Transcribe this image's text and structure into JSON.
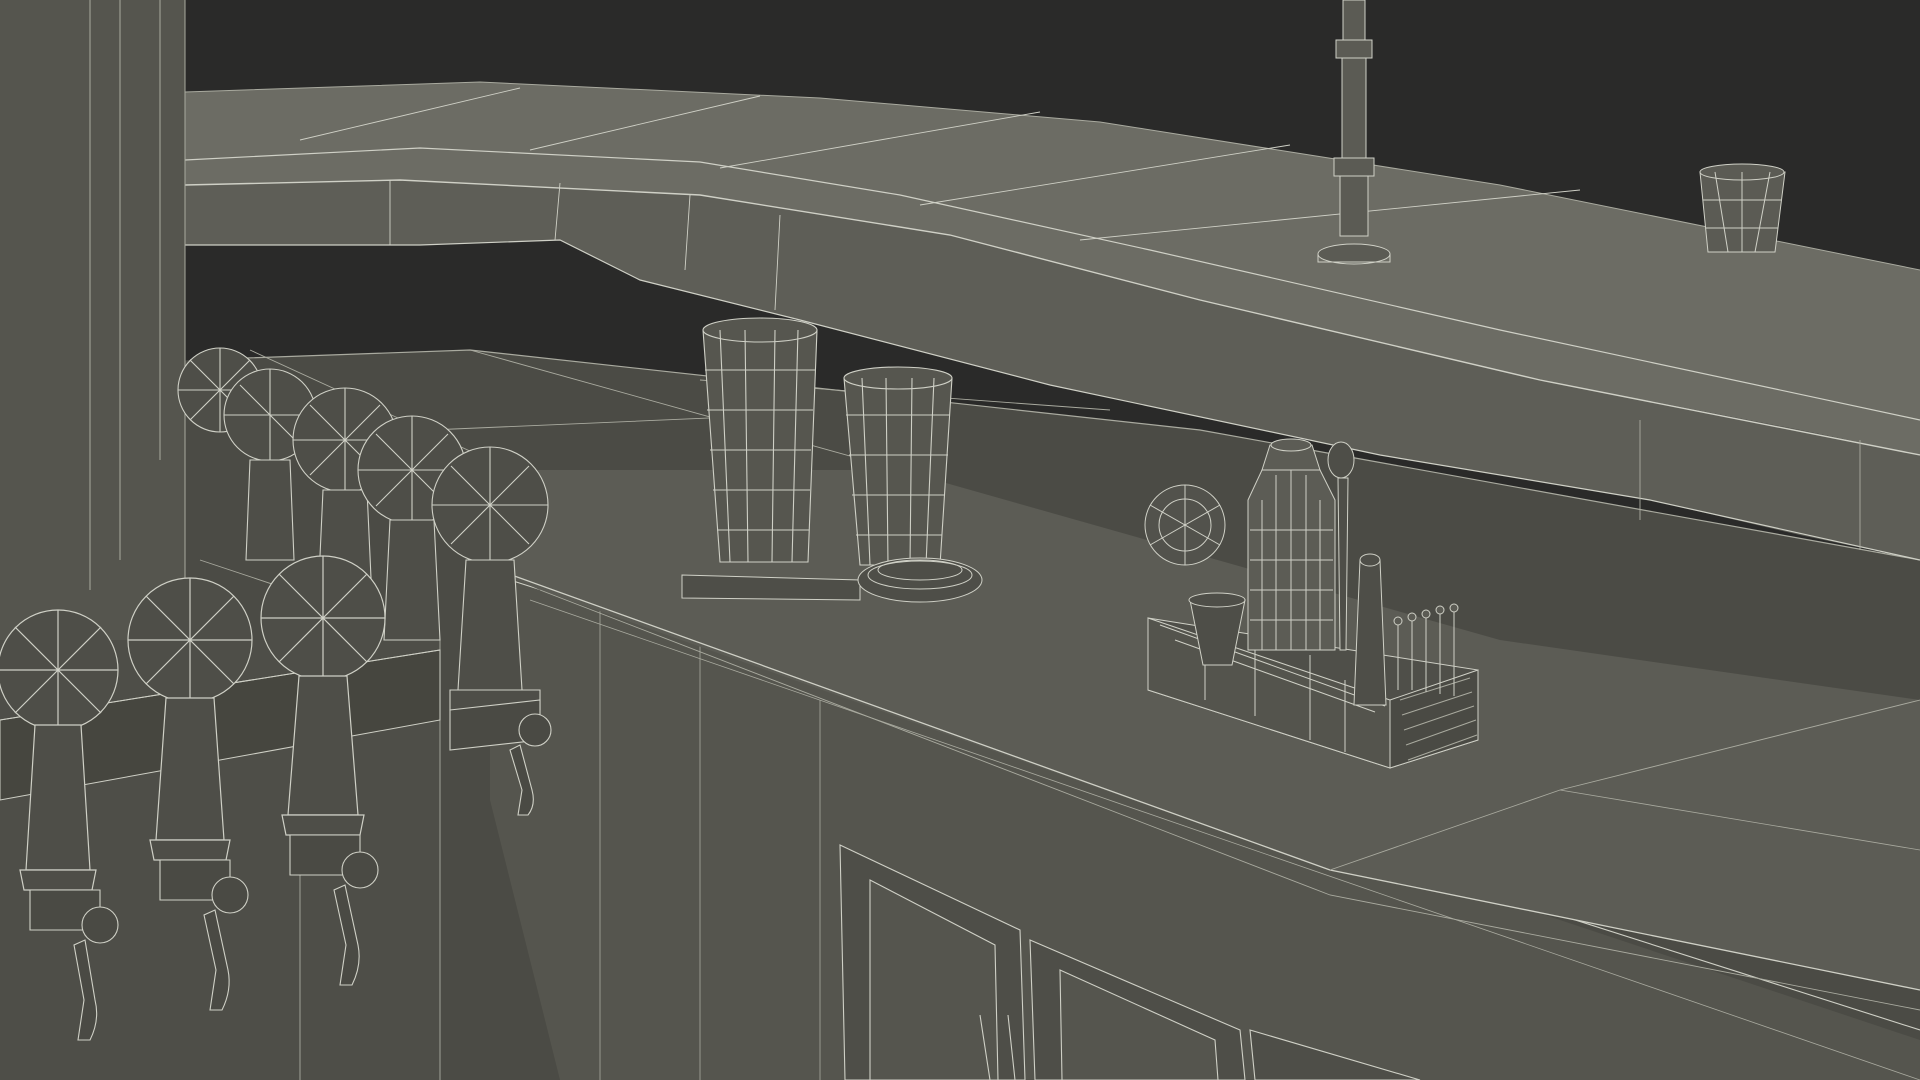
{
  "scene": {
    "colors": {
      "background": "#2a2a29",
      "surface_top": "#6c6c64",
      "surface_mid": "#5b5b54",
      "surface_dark": "#46463f",
      "shadow": "#3a3a35",
      "wire": "#cfd0c6",
      "wire_dim": "#a9aa9f"
    },
    "objects": [
      "bar-counter-top",
      "beer-tap-handles",
      "beer-faucets",
      "mixing-glasses",
      "cocktail-strainer",
      "bar-tool-caddy",
      "cocktail-shaker",
      "cocktail-picks",
      "shot-glass",
      "footrest-pole",
      "cabinet-doors"
    ]
  }
}
